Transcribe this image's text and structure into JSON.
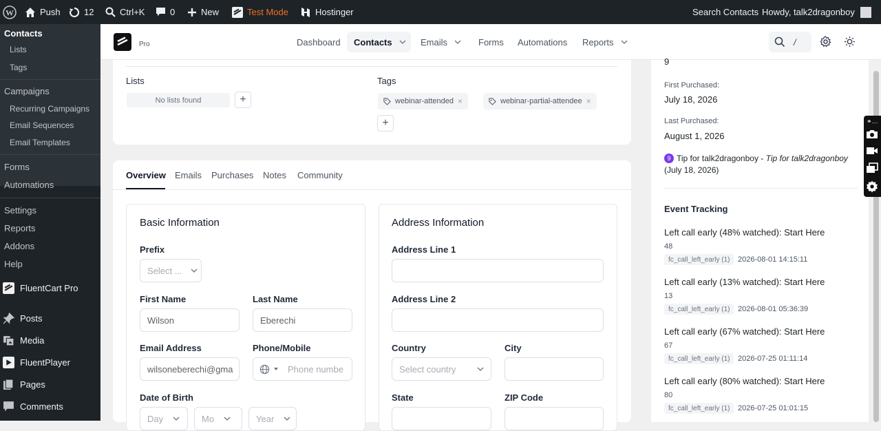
{
  "adminbar": {
    "push": "Push",
    "updates": "12",
    "search_shortcut": "Ctrl+K",
    "comments": "0",
    "new": "New",
    "test_mode": "Test Mode",
    "hostinger": "Hostinger",
    "search_contacts": "Search Contacts",
    "howdy": "Howdy, talk2dragonboy"
  },
  "sidebar": {
    "contacts": "Contacts",
    "lists": "Lists",
    "tags": "Tags",
    "campaigns": "Campaigns",
    "recurring": "Recurring Campaigns",
    "sequences": "Email Sequences",
    "templates": "Email Templates",
    "forms": "Forms",
    "automations": "Automations",
    "settings": "Settings",
    "reports": "Reports",
    "addons": "Addons",
    "help": "Help",
    "fluentcart": "FluentCart Pro",
    "posts": "Posts",
    "media": "Media",
    "fluentplayer": "FluentPlayer",
    "pages": "Pages",
    "comments": "Comments"
  },
  "topnav": {
    "brand_sub": "Pro",
    "items": [
      "Dashboard",
      "Contacts",
      "Emails",
      "Forms",
      "Automations",
      "Reports"
    ],
    "shortcut": "/"
  },
  "lists_tags": {
    "lists_label": "Lists",
    "no_lists": "No lists found",
    "tags_label": "Tags",
    "tags": [
      "webinar-attended",
      "webinar-partial-attendee"
    ]
  },
  "tabs": [
    "Overview",
    "Emails",
    "Purchases",
    "Notes",
    "Community"
  ],
  "basic": {
    "title": "Basic Information",
    "prefix_label": "Prefix",
    "prefix_placeholder": "Select ...",
    "first_name_label": "First Name",
    "first_name": "Wilson",
    "last_name_label": "Last Name",
    "last_name": "Eberechi",
    "email_label": "Email Address",
    "email": "wilsoneberechi@gma",
    "phone_label": "Phone/Mobile",
    "phone_placeholder": "Phone numbe",
    "dob_label": "Date of Birth",
    "dob_day": "Day",
    "dob_month": "Mo",
    "dob_year": "Year"
  },
  "address": {
    "title": "Address Information",
    "line1_label": "Address Line 1",
    "line2_label": "Address Line 2",
    "country_label": "Country",
    "country_placeholder": "Select country",
    "city_label": "City",
    "state_label": "State",
    "zip_label": "ZIP Code"
  },
  "right_panel": {
    "count_value": "9",
    "first_purchased_label": "First Purchased:",
    "first_purchased": "July 18, 2026",
    "last_purchased_label": "Last Purchased:",
    "last_purchased": "August 1, 2026",
    "tip_badge": "9",
    "tip_text": "Tip for talk2dragonboy - ",
    "tip_italic": "Tip for talk2dragonboy",
    "tip_date": "(July 18, 2026)",
    "event_title": "Event Tracking",
    "events": [
      {
        "title": "Left call early (48% watched): Start Here",
        "value": "48",
        "tag": "fc_call_left_early (1)",
        "time": "2026-08-01 14:15:11"
      },
      {
        "title": "Left call early (13% watched): Start Here",
        "value": "13",
        "tag": "fc_call_left_early (1)",
        "time": "2026-08-01 05:36:39"
      },
      {
        "title": "Left call early (67% watched): Start Here",
        "value": "67",
        "tag": "fc_call_left_early (1)",
        "time": "2026-07-25 01:11:14"
      },
      {
        "title": "Left call early (80% watched): Start Here",
        "value": "80",
        "tag": "fc_call_left_early (1)",
        "time": "2026-07-25 01:01:15"
      }
    ]
  },
  "colors": {
    "accent": "#f56e28",
    "admin_bg": "#1d2327",
    "badge": "#7c3aed"
  }
}
